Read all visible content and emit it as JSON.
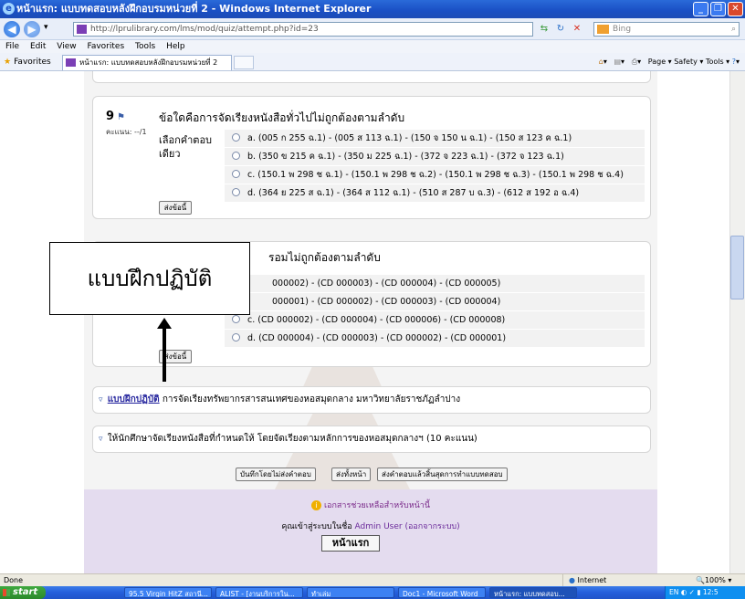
{
  "window": {
    "title": "หน้าแรก: แบบทดสอบหลังฝึกอบรมหน่วยที่ 2 - Windows Internet Explorer",
    "buttons": [
      "minimize",
      "maximize",
      "close"
    ]
  },
  "address_bar": {
    "url": "http://lprulibrary.com/lms/mod/quiz/attempt.php?id=23",
    "search_placeholder": "Bing"
  },
  "menu": [
    "File",
    "Edit",
    "View",
    "Favorites",
    "Tools",
    "Help"
  ],
  "favorites_bar": {
    "favorites_label": "Favorites",
    "tab_title": "หน้าแรก: แบบทดสอบหลังฝึกอบรมหน่วยที่ 2",
    "commands": "Page ▾  Safety ▾  Tools ▾"
  },
  "question9": {
    "number": "9",
    "mark": "คะแนน: --/1",
    "text": "ข้อใดคือการจัดเรียงหนังสือทั่วไปไม่ถูกต้องตามลำดับ",
    "choose_label": "เลือกคำตอบเดียว",
    "answers": [
      "a. (005 ก 255 ฉ.1) - (005 ส 113 ฉ.1) - (150 จ 150 น ฉ.1) - (150 ส 123 ค ฉ.1)",
      "b. (350 ข 215 ค ฉ.1) - (350 ม 225 ฉ.1) - (372 จ 223 ฉ.1) - (372 จ 123 ฉ.1)",
      "c. (150.1 พ 298 ช ฉ.1) - (150.1 พ 298 ช ฉ.2) - (150.1 พ 298 ช ฉ.3) - (150.1 พ 298 ช ฉ.4)",
      "d. (364 ย 225 ส ฉ.1) - (364 ส 112 ฉ.1) - (510 ส 287 บ ฉ.3) - (612 ส 192 อ ฉ.4)"
    ],
    "submit": "ส่งข้อนี้"
  },
  "question10": {
    "text": "รอมไม่ถูกต้องตามลำดับ",
    "answers": [
      "000002) - (CD 000003) - (CD 000004) - (CD 000005)",
      "000001) - (CD 000002) - (CD 000003) - (CD 000004)",
      "c. (CD 000002) - (CD 000004) - (CD 000006) - (CD 000008)",
      "d. (CD 000004) - (CD 000003) - (CD 000002) - (CD 000001)"
    ],
    "submit": "ส่งข้อนี้"
  },
  "callout": "แบบฝึกปฏิบัติ",
  "section_practice": {
    "link": "แบบฝึกปฏิบัติ",
    "text": "การจัดเรียงทรัพยากรสารสนเทศของหอสมุดกลาง มหาวิทยาลัยราชภัฏลำปาง"
  },
  "section_task": "ให้นักศึกษาจัดเรียงหนังสือที่กำหนดให้ โดยจัดเรียงตามหลักการของหอสมุดกลางฯ (10 คะแนน)",
  "action_buttons": [
    "บันทึกโดยไม่ส่งคำตอบ",
    "ส่งทั้งหน้า",
    "ส่งคำตอบแล้วสิ้นสุดการทำแบบทดสอบ"
  ],
  "footer": {
    "help": "เอกสารช่วยเหลือสำหรับหน้านี้",
    "login_prefix": "คุณเข้าสู่ระบบในชื่อ",
    "user": "Admin User",
    "logout": "(ออกจากระบบ)",
    "home": "หน้าแรก"
  },
  "statusbar": {
    "status": "Done",
    "zone": "Internet",
    "zoom": "100%"
  },
  "taskbar": {
    "start": "start",
    "items": [
      "95.5 Virgin HitZ สถานี...",
      "ALIST - [งานบริการใน...",
      "ทำเล่ม",
      "Doc1 - Microsoft Word",
      "หน้าแรก: แบบทดสอบ..."
    ],
    "tray_time": "12:5"
  }
}
